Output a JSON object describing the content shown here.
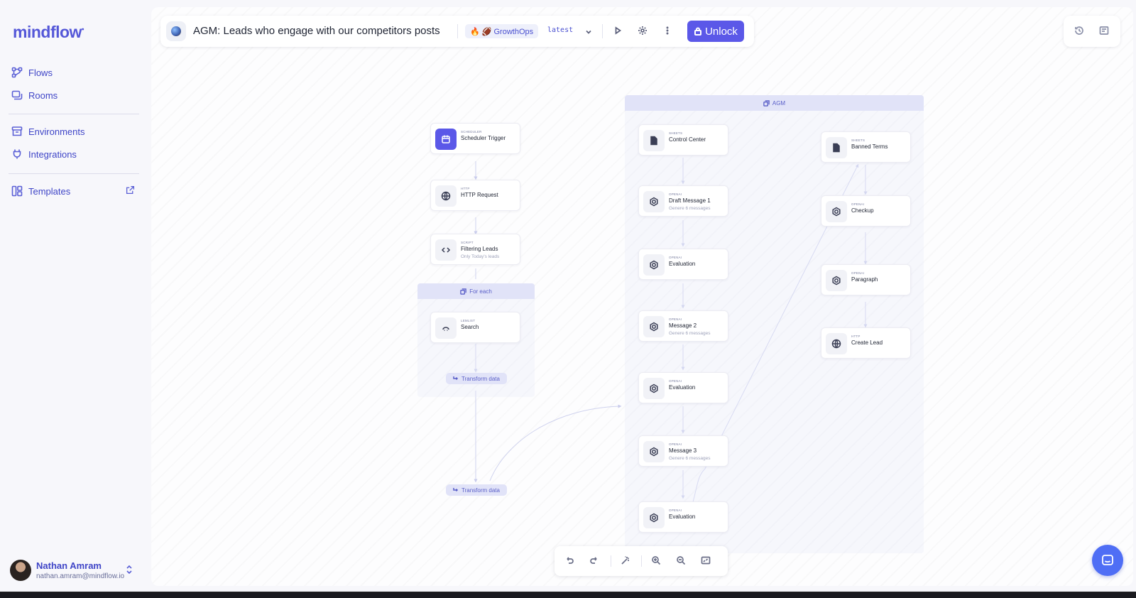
{
  "sidebar": {
    "logo": "mindflow",
    "items": [
      {
        "label": "Flows",
        "icon": "flows-icon"
      },
      {
        "label": "Rooms",
        "icon": "rooms-icon"
      },
      {
        "label": "Environments",
        "icon": "environments-icon"
      },
      {
        "label": "Integrations",
        "icon": "integrations-icon"
      },
      {
        "label": "Templates",
        "icon": "templates-icon"
      }
    ],
    "user": {
      "name": "Nathan Amram",
      "email": "nathan.amram@mindflow.io"
    }
  },
  "header": {
    "title": "AGM: Leads who engage with our competitors posts",
    "environment": "🔥 🏈 GrowthOps",
    "version": "latest",
    "unlock_label": "Unlock"
  },
  "flow": {
    "groups": {
      "foreach": {
        "label": "For each"
      },
      "agm": {
        "label": "AGM"
      }
    },
    "nodes": {
      "scheduler": {
        "type": "SCHEDULER",
        "label": "Scheduler Trigger",
        "sub": ""
      },
      "http_request": {
        "type": "HTTP",
        "label": "HTTP Request",
        "sub": ""
      },
      "filtering": {
        "type": "SCRIPT",
        "label": "Filtering Leads",
        "sub": "Only Today's leads"
      },
      "search": {
        "type": "LEMLIST",
        "label": "Search",
        "sub": ""
      },
      "control_center": {
        "type": "SHEETS",
        "label": "Control Center",
        "sub": ""
      },
      "draft1": {
        "type": "OPENAI",
        "label": "Draft Message 1",
        "sub": "Genere 6 messages"
      },
      "eval1": {
        "type": "OPENAI",
        "label": "Evaluation",
        "sub": ""
      },
      "message2": {
        "type": "OPENAI",
        "label": "Message 2",
        "sub": "Genere 6 messages"
      },
      "eval2": {
        "type": "OPENAI",
        "label": "Evaluation",
        "sub": ""
      },
      "message3": {
        "type": "OPENAI",
        "label": "Message 3",
        "sub": "Genere 6 messages"
      },
      "eval3": {
        "type": "OPENAI",
        "label": "Evaluation",
        "sub": ""
      },
      "banned": {
        "type": "SHEETS",
        "label": "Banned Terms",
        "sub": ""
      },
      "checkup": {
        "type": "OPENAI",
        "label": "Checkup",
        "sub": ""
      },
      "paragraph": {
        "type": "OPENAI",
        "label": "Paragraph",
        "sub": ""
      },
      "create_lead": {
        "type": "HTTP",
        "label": "Create  Lead",
        "sub": ""
      }
    },
    "pills": {
      "transform1": "Transform data",
      "transform2": "Transform data"
    }
  },
  "colors": {
    "accent": "#5b58e8",
    "brand": "#5457d8",
    "group_header": "#e1e3f8"
  }
}
